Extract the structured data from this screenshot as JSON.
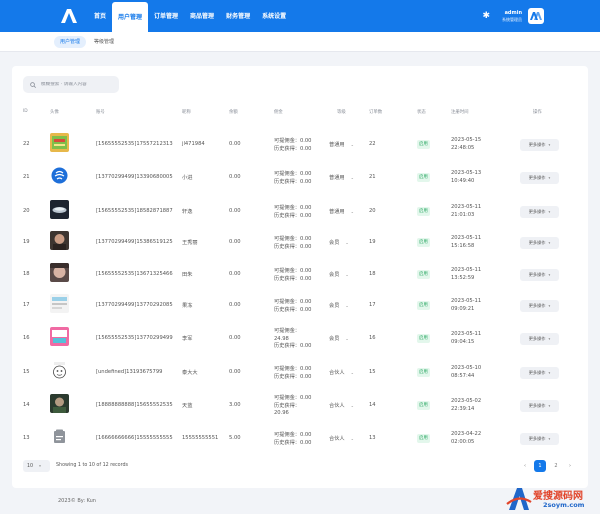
{
  "topnav": {
    "items": [
      {
        "label": "首页"
      },
      {
        "label": "用户管理"
      },
      {
        "label": "订单管理"
      },
      {
        "label": "商品管理"
      },
      {
        "label": "财务管理"
      },
      {
        "label": "系统设置"
      }
    ],
    "active_index": 1,
    "user": {
      "name": "admin",
      "role": "系统管理员"
    },
    "avatar_text": "AA"
  },
  "subnav": {
    "tabs": [
      {
        "label": "用户管理"
      },
      {
        "label": "等级管理"
      }
    ]
  },
  "search": {
    "placeholder": "模糊搜索 · 请输入内容"
  },
  "table": {
    "headers": {
      "id": "ID",
      "avatar": "头像",
      "account": "账号",
      "nickname": "昵称",
      "balance": "余额",
      "commission": "佣金",
      "level": "等级",
      "orders": "订单数",
      "status": "状态",
      "created": "注册时间",
      "action": "操作"
    },
    "rows": [
      {
        "id": "22",
        "thumb": "t1",
        "account": "[15655552535]17557212313",
        "nickname": "jl471984",
        "balance": "0.00",
        "withdrawable": "可提佣金：0.00",
        "history": "历史获得：0.00",
        "level": "普通用",
        "orders": "22",
        "status": "启用",
        "date": "2023-05-15",
        "time": "22:48:05",
        "more": "更多操作"
      },
      {
        "id": "21",
        "thumb": "t2",
        "account": "[13770299499]13390680005",
        "nickname": "小进",
        "balance": "0.00",
        "withdrawable": "可提佣金：0.00",
        "history": "历史获得：0.00",
        "level": "普通用",
        "orders": "21",
        "status": "启用",
        "date": "2023-05-13",
        "time": "10:49:40",
        "more": "更多操作"
      },
      {
        "id": "20",
        "thumb": "t3",
        "account": "[15655552535]18582871887",
        "nickname": "轩逸",
        "balance": "0.00",
        "withdrawable": "可提佣金：0.00",
        "history": "历史获得：0.00",
        "level": "普通用",
        "orders": "20",
        "status": "启用",
        "date": "2023-05-11",
        "time": "21:01:03",
        "more": "更多操作"
      },
      {
        "id": "19",
        "thumb": "t4",
        "account": "[13770299499]15386519125",
        "nickname": "王秀丽",
        "balance": "0.00",
        "withdrawable": "可提佣金：0.00",
        "history": "历史获得：0.00",
        "level": "会员",
        "orders": "19",
        "status": "启用",
        "date": "2023-05-11",
        "time": "15:16:58",
        "more": "更多操作"
      },
      {
        "id": "18",
        "thumb": "t5",
        "account": "[15655552535]13671325466",
        "nickname": "田朱",
        "balance": "0.00",
        "withdrawable": "可提佣金：0.00",
        "history": "历史获得：0.00",
        "level": "会员",
        "orders": "18",
        "status": "启用",
        "date": "2023-05-11",
        "time": "13:52:59",
        "more": "更多操作"
      },
      {
        "id": "17",
        "thumb": "t6",
        "account": "[13770299499]13770292085",
        "nickname": "果冻",
        "balance": "0.00",
        "withdrawable": "可提佣金：0.00",
        "history": "历史获得：0.00",
        "level": "会员",
        "orders": "17",
        "status": "启用",
        "date": "2023-05-11",
        "time": "09:09:21",
        "more": "更多操作"
      },
      {
        "id": "16",
        "thumb": "t7",
        "account": "[15655552535]13770299499",
        "nickname": "李军",
        "balance": "0.00",
        "withdrawable": "可提佣金：",
        "withdrawable2": "24.98",
        "history": "历史获得：0.00",
        "level": "会员",
        "orders": "16",
        "status": "启用",
        "date": "2023-05-11",
        "time": "09:04:15",
        "more": "更多操作"
      },
      {
        "id": "15",
        "thumb": "t8",
        "account": "[undefined]13193675799",
        "nickname": "泰大大",
        "balance": "0.00",
        "withdrawable": "可提佣金：0.00",
        "history": "历史获得：0.00",
        "level": "合伙人",
        "orders": "15",
        "status": "启用",
        "date": "2023-05-10",
        "time": "08:57:44",
        "more": "更多操作"
      },
      {
        "id": "14",
        "thumb": "t9",
        "account": "[18888888888]15655552535",
        "nickname": "天蓝",
        "balance": "3.00",
        "withdrawable": "可提佣金：0.00",
        "history": "历史获得：",
        "history2": "20.96",
        "level": "合伙人",
        "orders": "14",
        "status": "启用",
        "date": "2023-05-02",
        "time": "22:39:14",
        "more": "更多操作"
      },
      {
        "id": "13",
        "thumb": "t10",
        "account": "[16666666666]15555555555",
        "nickname": "15555555551",
        "balance": "5.00",
        "withdrawable": "可提佣金：0.00",
        "history": "历史获得：0.00",
        "level": "合伙人",
        "orders": "13",
        "status": "启用",
        "date": "2023-04-22",
        "time": "02:00:05",
        "more": "更多操作"
      }
    ]
  },
  "pagination": {
    "page_size": "10",
    "info": "Showing 1 to 10 of 12 records",
    "prev": "‹",
    "pages": [
      "1",
      "2"
    ],
    "next": "›",
    "current": "1"
  },
  "footer": {
    "copyright": "2023© By: Kun"
  },
  "watermark": {
    "text1": "爱搜源码网",
    "text2": "2soym.com"
  },
  "colors": {
    "primary": "#1479ea",
    "status_green": "#25a55f"
  }
}
